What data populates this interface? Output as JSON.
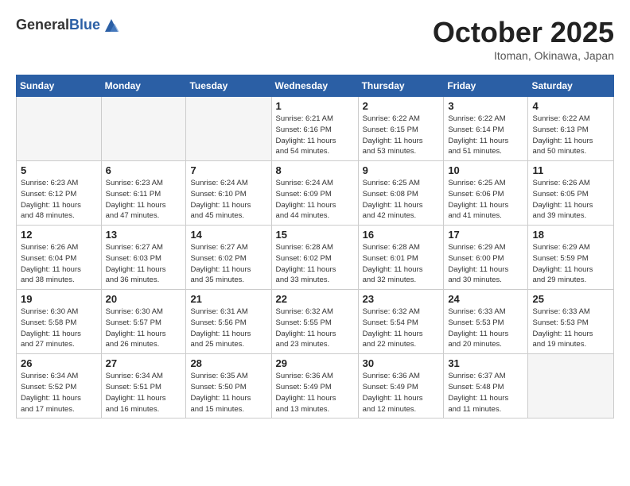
{
  "header": {
    "logo_general": "General",
    "logo_blue": "Blue",
    "month_title": "October 2025",
    "location": "Itoman, Okinawa, Japan"
  },
  "weekdays": [
    "Sunday",
    "Monday",
    "Tuesday",
    "Wednesday",
    "Thursday",
    "Friday",
    "Saturday"
  ],
  "weeks": [
    [
      {
        "day": "",
        "info": ""
      },
      {
        "day": "",
        "info": ""
      },
      {
        "day": "",
        "info": ""
      },
      {
        "day": "1",
        "info": "Sunrise: 6:21 AM\nSunset: 6:16 PM\nDaylight: 11 hours\nand 54 minutes."
      },
      {
        "day": "2",
        "info": "Sunrise: 6:22 AM\nSunset: 6:15 PM\nDaylight: 11 hours\nand 53 minutes."
      },
      {
        "day": "3",
        "info": "Sunrise: 6:22 AM\nSunset: 6:14 PM\nDaylight: 11 hours\nand 51 minutes."
      },
      {
        "day": "4",
        "info": "Sunrise: 6:22 AM\nSunset: 6:13 PM\nDaylight: 11 hours\nand 50 minutes."
      }
    ],
    [
      {
        "day": "5",
        "info": "Sunrise: 6:23 AM\nSunset: 6:12 PM\nDaylight: 11 hours\nand 48 minutes."
      },
      {
        "day": "6",
        "info": "Sunrise: 6:23 AM\nSunset: 6:11 PM\nDaylight: 11 hours\nand 47 minutes."
      },
      {
        "day": "7",
        "info": "Sunrise: 6:24 AM\nSunset: 6:10 PM\nDaylight: 11 hours\nand 45 minutes."
      },
      {
        "day": "8",
        "info": "Sunrise: 6:24 AM\nSunset: 6:09 PM\nDaylight: 11 hours\nand 44 minutes."
      },
      {
        "day": "9",
        "info": "Sunrise: 6:25 AM\nSunset: 6:08 PM\nDaylight: 11 hours\nand 42 minutes."
      },
      {
        "day": "10",
        "info": "Sunrise: 6:25 AM\nSunset: 6:06 PM\nDaylight: 11 hours\nand 41 minutes."
      },
      {
        "day": "11",
        "info": "Sunrise: 6:26 AM\nSunset: 6:05 PM\nDaylight: 11 hours\nand 39 minutes."
      }
    ],
    [
      {
        "day": "12",
        "info": "Sunrise: 6:26 AM\nSunset: 6:04 PM\nDaylight: 11 hours\nand 38 minutes."
      },
      {
        "day": "13",
        "info": "Sunrise: 6:27 AM\nSunset: 6:03 PM\nDaylight: 11 hours\nand 36 minutes."
      },
      {
        "day": "14",
        "info": "Sunrise: 6:27 AM\nSunset: 6:02 PM\nDaylight: 11 hours\nand 35 minutes."
      },
      {
        "day": "15",
        "info": "Sunrise: 6:28 AM\nSunset: 6:02 PM\nDaylight: 11 hours\nand 33 minutes."
      },
      {
        "day": "16",
        "info": "Sunrise: 6:28 AM\nSunset: 6:01 PM\nDaylight: 11 hours\nand 32 minutes."
      },
      {
        "day": "17",
        "info": "Sunrise: 6:29 AM\nSunset: 6:00 PM\nDaylight: 11 hours\nand 30 minutes."
      },
      {
        "day": "18",
        "info": "Sunrise: 6:29 AM\nSunset: 5:59 PM\nDaylight: 11 hours\nand 29 minutes."
      }
    ],
    [
      {
        "day": "19",
        "info": "Sunrise: 6:30 AM\nSunset: 5:58 PM\nDaylight: 11 hours\nand 27 minutes."
      },
      {
        "day": "20",
        "info": "Sunrise: 6:30 AM\nSunset: 5:57 PM\nDaylight: 11 hours\nand 26 minutes."
      },
      {
        "day": "21",
        "info": "Sunrise: 6:31 AM\nSunset: 5:56 PM\nDaylight: 11 hours\nand 25 minutes."
      },
      {
        "day": "22",
        "info": "Sunrise: 6:32 AM\nSunset: 5:55 PM\nDaylight: 11 hours\nand 23 minutes."
      },
      {
        "day": "23",
        "info": "Sunrise: 6:32 AM\nSunset: 5:54 PM\nDaylight: 11 hours\nand 22 minutes."
      },
      {
        "day": "24",
        "info": "Sunrise: 6:33 AM\nSunset: 5:53 PM\nDaylight: 11 hours\nand 20 minutes."
      },
      {
        "day": "25",
        "info": "Sunrise: 6:33 AM\nSunset: 5:53 PM\nDaylight: 11 hours\nand 19 minutes."
      }
    ],
    [
      {
        "day": "26",
        "info": "Sunrise: 6:34 AM\nSunset: 5:52 PM\nDaylight: 11 hours\nand 17 minutes."
      },
      {
        "day": "27",
        "info": "Sunrise: 6:34 AM\nSunset: 5:51 PM\nDaylight: 11 hours\nand 16 minutes."
      },
      {
        "day": "28",
        "info": "Sunrise: 6:35 AM\nSunset: 5:50 PM\nDaylight: 11 hours\nand 15 minutes."
      },
      {
        "day": "29",
        "info": "Sunrise: 6:36 AM\nSunset: 5:49 PM\nDaylight: 11 hours\nand 13 minutes."
      },
      {
        "day": "30",
        "info": "Sunrise: 6:36 AM\nSunset: 5:49 PM\nDaylight: 11 hours\nand 12 minutes."
      },
      {
        "day": "31",
        "info": "Sunrise: 6:37 AM\nSunset: 5:48 PM\nDaylight: 11 hours\nand 11 minutes."
      },
      {
        "day": "",
        "info": ""
      }
    ]
  ]
}
